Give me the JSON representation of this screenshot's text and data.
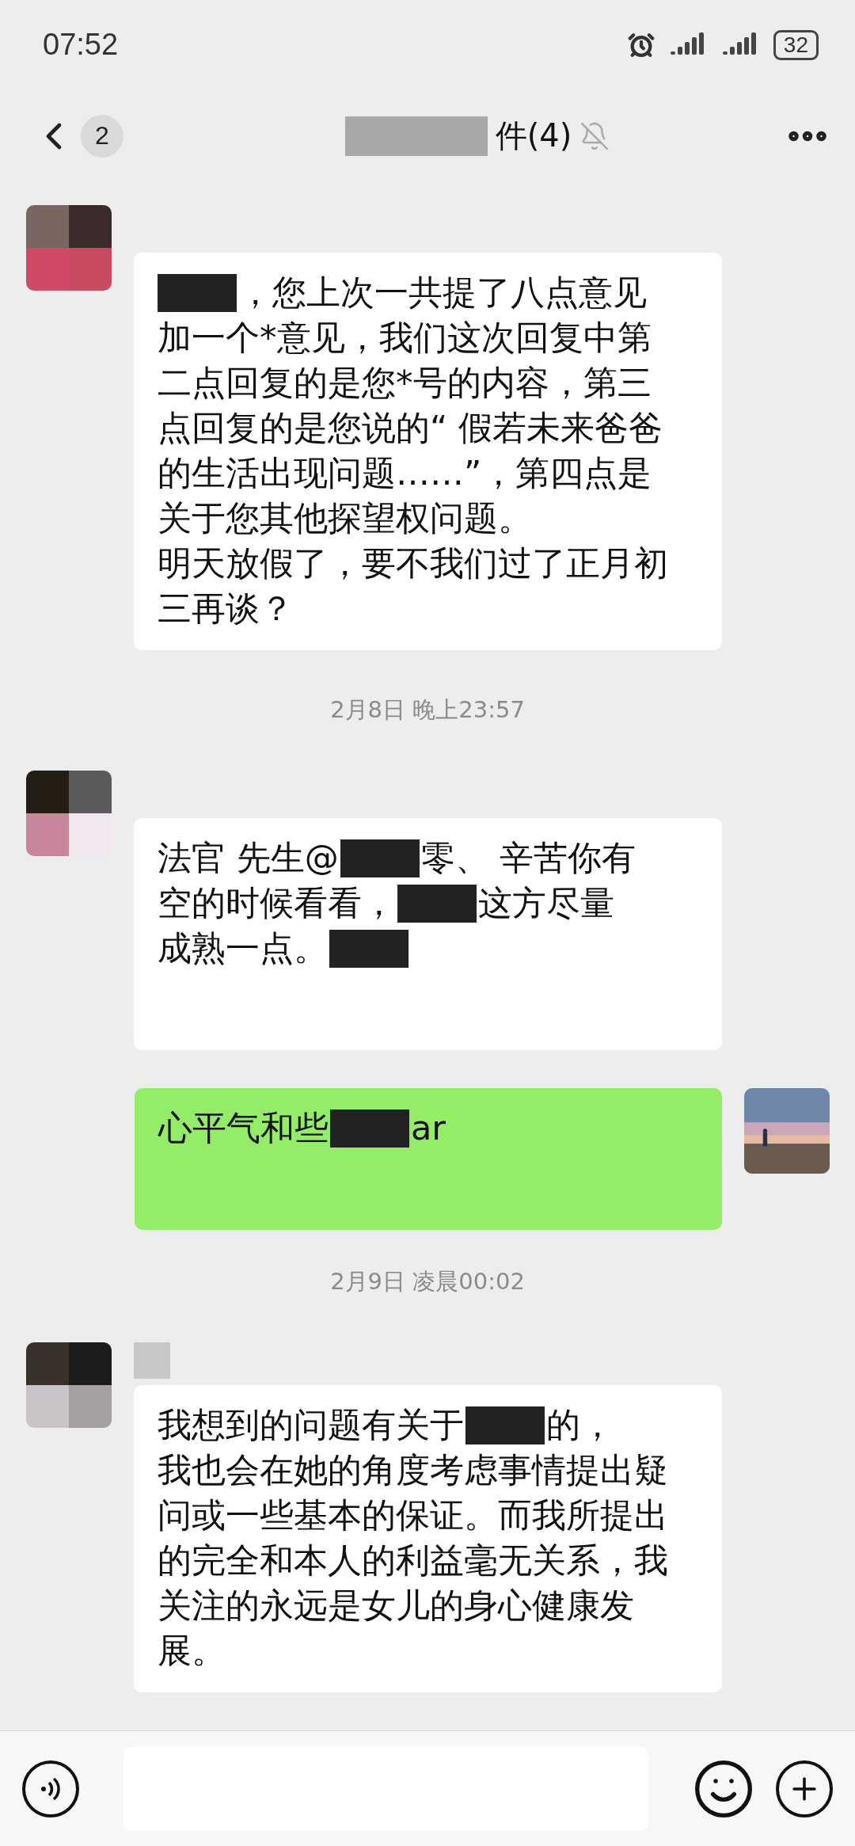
{
  "status_bar": {
    "time": "07:52",
    "battery": "32"
  },
  "header": {
    "back_count": "2",
    "title": "件(4)",
    "muted": true
  },
  "messages": [
    {
      "kind": "incoming",
      "sender_hidden": false,
      "lines": [
        [
          {
            "kind": "redaction"
          },
          {
            "kind": "text",
            "text": "，您上次一共提了八点意见"
          }
        ],
        [
          {
            "kind": "text",
            "text": "加一个*意见，我们这次回复中第"
          }
        ],
        [
          {
            "kind": "text",
            "text": "二点回复的是您*号的内容，第三"
          }
        ],
        [
          {
            "kind": "text",
            "text": "点回复的是您说的“ 假若未来爸爸"
          }
        ],
        [
          {
            "kind": "text",
            "text": "的生活出现问题……”，第四点是"
          }
        ],
        [
          {
            "kind": "text",
            "text": "关于您其他探望权问题。"
          }
        ],
        [
          {
            "kind": "text",
            "text": "明天放假了，要不我们过了正月初"
          }
        ],
        [
          {
            "kind": "text",
            "text": "三再谈？"
          }
        ]
      ]
    },
    {
      "kind": "time",
      "text": "2月8日 晚上23:57"
    },
    {
      "kind": "incoming",
      "sender_hidden": false,
      "lines": [
        [
          {
            "kind": "text",
            "text": "法官 先生@"
          },
          {
            "kind": "redaction"
          },
          {
            "kind": "text",
            "text": "零、 辛苦你有"
          }
        ],
        [
          {
            "kind": "text",
            "text": "空的时候看看，"
          },
          {
            "kind": "redaction"
          },
          {
            "kind": "text",
            "text": "这方尽量"
          }
        ],
        [
          {
            "kind": "text",
            "text": "成熟一点。"
          },
          {
            "kind": "redaction"
          }
        ]
      ]
    },
    {
      "kind": "outgoing",
      "lines": [
        [
          {
            "kind": "text",
            "text": "心平气和些"
          },
          {
            "kind": "redaction"
          },
          {
            "kind": "text",
            "text": "ar"
          }
        ]
      ]
    },
    {
      "kind": "time",
      "text": "2月9日 凌晨00:02"
    },
    {
      "kind": "incoming",
      "sender_hidden": true,
      "lines": [
        [
          {
            "kind": "text",
            "text": "我想到的问题有关于"
          },
          {
            "kind": "redaction"
          },
          {
            "kind": "text",
            "text": "的，"
          }
        ],
        [
          {
            "kind": "text",
            "text": "我也会在她的角度考虑事情提出疑"
          }
        ],
        [
          {
            "kind": "text",
            "text": "问或一些基本的保证。而我所提出"
          }
        ],
        [
          {
            "kind": "text",
            "text": "的完全和本人的利益毫无关系，我"
          }
        ],
        [
          {
            "kind": "text",
            "text": "关注的永远是女儿的身心健康发"
          }
        ],
        [
          {
            "kind": "text",
            "text": "展。"
          }
        ]
      ]
    }
  ]
}
